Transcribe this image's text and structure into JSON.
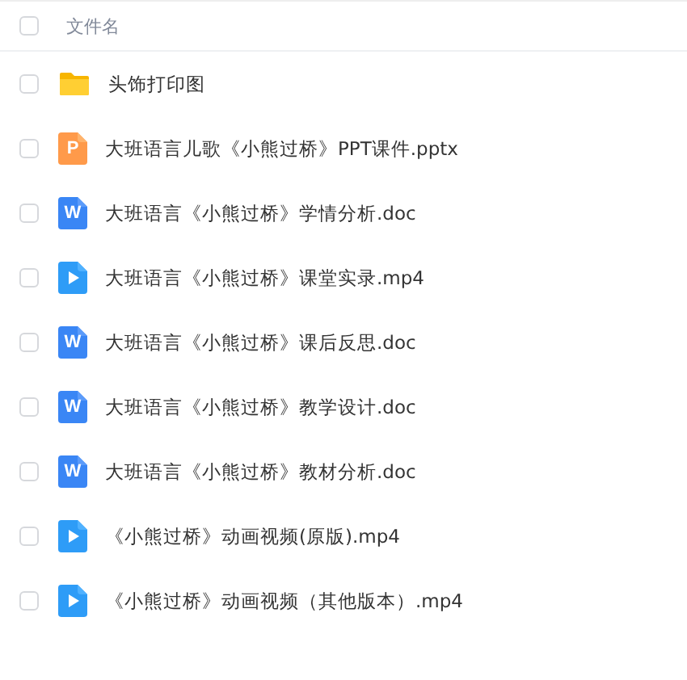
{
  "header": {
    "checked": false,
    "label": "文件名"
  },
  "files": [
    {
      "kind": "folder",
      "name": "头饰打印图",
      "checked": false
    },
    {
      "kind": "ppt",
      "icon_letter": "P",
      "name": "大班语言儿歌《小熊过桥》PPT课件.pptx",
      "checked": false
    },
    {
      "kind": "word",
      "icon_letter": "W",
      "name": "大班语言《小熊过桥》学情分析.doc",
      "checked": false
    },
    {
      "kind": "video",
      "name": "大班语言《小熊过桥》课堂实录.mp4",
      "checked": false
    },
    {
      "kind": "word",
      "icon_letter": "W",
      "name": "大班语言《小熊过桥》课后反思.doc",
      "checked": false
    },
    {
      "kind": "word",
      "icon_letter": "W",
      "name": "大班语言《小熊过桥》教学设计.doc",
      "checked": false
    },
    {
      "kind": "word",
      "icon_letter": "W",
      "name": "大班语言《小熊过桥》教材分析.doc",
      "checked": false
    },
    {
      "kind": "video",
      "name": "《小熊过桥》动画视频(原版).mp4",
      "checked": false
    },
    {
      "kind": "video",
      "name": "《小熊过桥》动画视频（其他版本）.mp4",
      "checked": false
    }
  ]
}
